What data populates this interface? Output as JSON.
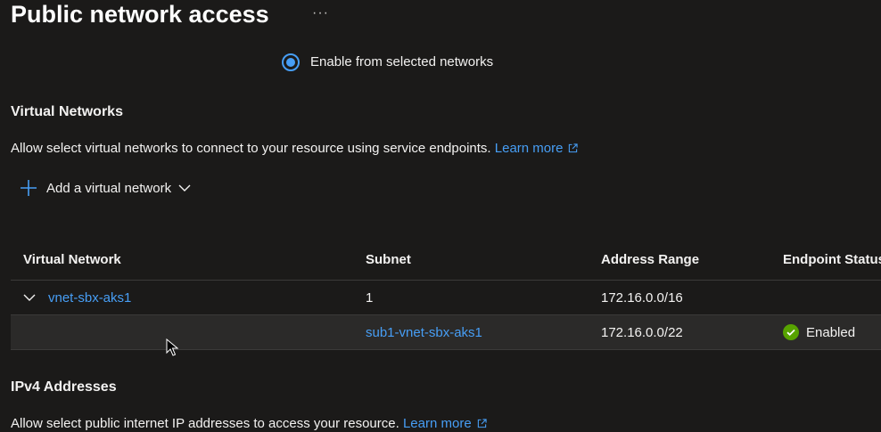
{
  "header": {
    "title": "Public network access",
    "more_label": "···"
  },
  "access_option": {
    "label": "Enable from selected networks"
  },
  "virtual_networks": {
    "heading": "Virtual Networks",
    "description": "Allow select virtual networks to connect to your resource using service endpoints.",
    "learn_more": "Learn more",
    "add_label": "Add a virtual network",
    "columns": [
      "Virtual Network",
      "Subnet",
      "Address Range",
      "Endpoint Status"
    ],
    "network_row": {
      "name": "vnet-sbx-aks1",
      "subnet": "1",
      "address_range": "172.16.0.0/16",
      "status": ""
    },
    "subnet_row": {
      "name": "",
      "subnet": "sub1-vnet-sbx-aks1",
      "address_range": "172.16.0.0/22",
      "status": "Enabled"
    }
  },
  "ipv4": {
    "heading": "IPv4 Addresses",
    "description": "Allow select public internet IP addresses to access your resource.",
    "learn_more": "Learn more"
  },
  "colors": {
    "accent": "#479ef5",
    "success": "#57a300",
    "background": "#1b1a19"
  }
}
